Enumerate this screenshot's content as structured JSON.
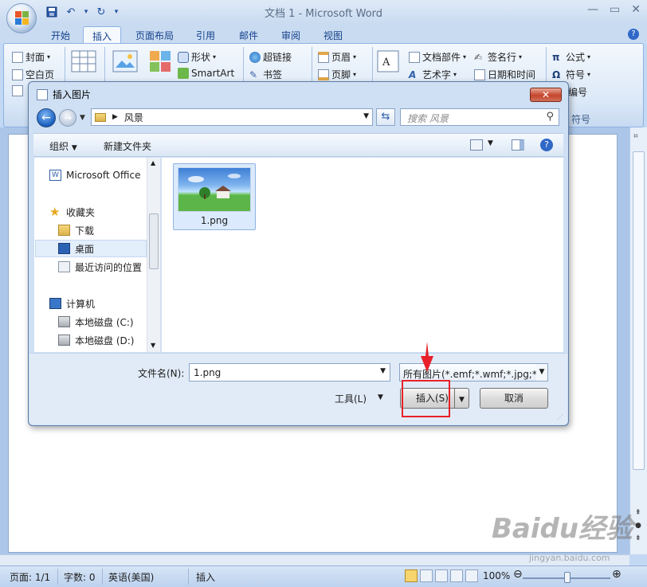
{
  "app": {
    "title": "文档 1 - Microsoft Word",
    "qat": [
      "save-icon",
      "undo-icon",
      "redo-icon"
    ],
    "window_controls": [
      "—",
      "▭",
      "✕"
    ]
  },
  "ribbon": {
    "tabs": [
      "开始",
      "插入",
      "页面布局",
      "引用",
      "邮件",
      "审阅",
      "视图"
    ],
    "active_tab": "插入",
    "pages_group": [
      "封面",
      "空白页"
    ],
    "illustrations": [
      "形状",
      "SmartArt"
    ],
    "links": [
      "超链接",
      "书签"
    ],
    "header_footer": [
      "页眉",
      "页脚"
    ],
    "text_group": [
      "文档部件",
      "艺术字"
    ],
    "text_group2": [
      "签名行",
      "日期和时间"
    ],
    "symbols": [
      "公式",
      "符号",
      "编号"
    ],
    "symbols_label": "符号"
  },
  "dialog": {
    "title": "插入图片",
    "close_label": "✕",
    "address": "风景",
    "search_placeholder": "搜索 风景",
    "toolbar": {
      "organize": "组织",
      "new_folder": "新建文件夹"
    },
    "nav": {
      "favorites_root": "Microsoft Office",
      "favorites": "收藏夹",
      "download": "下载",
      "desktop": "桌面",
      "recent": "最近访问的位置",
      "computer": "计算机",
      "drive_c": "本地磁盘 (C:)",
      "drive_d": "本地磁盘 (D:)"
    },
    "file": {
      "name": "1.png"
    },
    "filename_label": "文件名(N):",
    "filename_value": "1.png",
    "filter_value": "所有图片(*.emf;*.wmf;*.jpg;*.jp",
    "tools_label": "工具(L)",
    "insert_label": "插入(S)",
    "cancel_label": "取消"
  },
  "status": {
    "page": "页面: 1/1",
    "words": "字数: 0",
    "language": "英语(美国)",
    "mode": "插入",
    "zoom": "100%"
  },
  "watermark": {
    "brand": "Baidu经验",
    "url": "jingyan.baidu.com"
  }
}
